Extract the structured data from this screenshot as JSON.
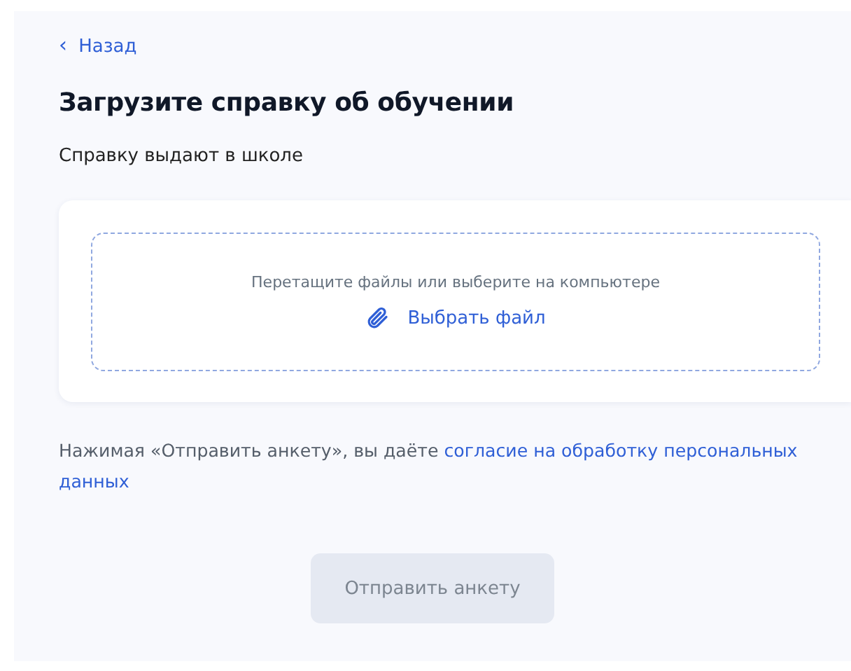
{
  "back_link": {
    "icon": "‹",
    "label": "Назад"
  },
  "title": "Загрузите справку об обучении",
  "subtitle": "Справку выдают в школе",
  "upload": {
    "hint": "Перетащите файлы или выберите на компьютере",
    "button": "Выбрать файл"
  },
  "consent": {
    "text": "Нажимая «Отправить анкету», вы даёте",
    "link_lines": [
      "согласие на обработку персональных",
      "данных"
    ]
  },
  "submit": {
    "label": "Отправить анкету",
    "disabled": true
  }
}
